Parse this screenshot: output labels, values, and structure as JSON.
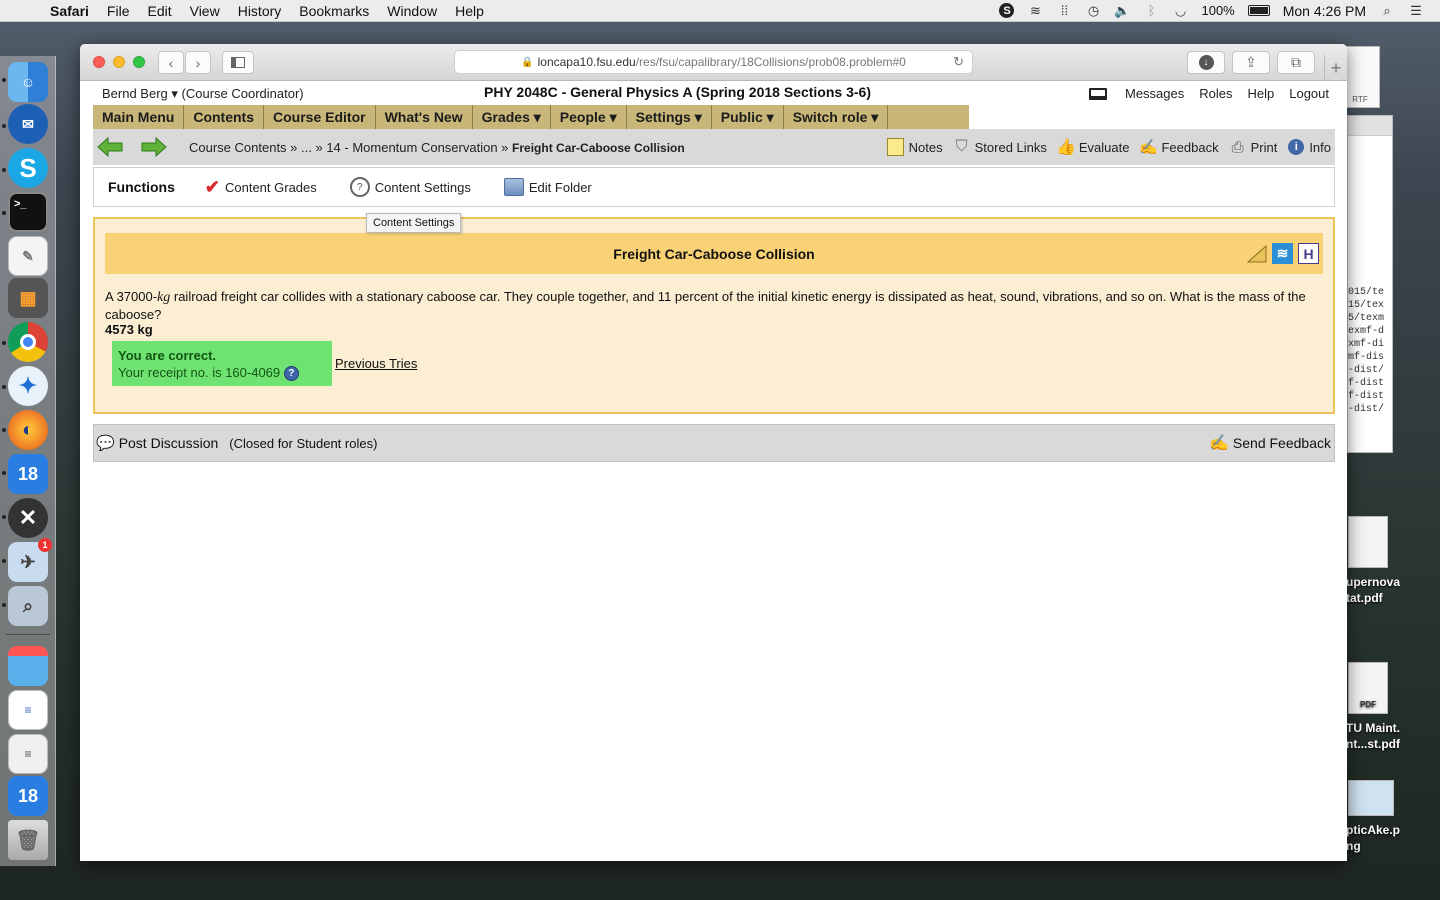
{
  "menubar": {
    "app": "Safari",
    "items": [
      "File",
      "Edit",
      "View",
      "History",
      "Bookmarks",
      "Window",
      "Help"
    ],
    "battery": "100%",
    "clock": "Mon 4:26 PM"
  },
  "dock": {
    "items": [
      "finder",
      "thunderbird",
      "skype",
      "terminal",
      "textedit",
      "calculator",
      "chrome",
      "safari",
      "firefox",
      "calendar-18",
      "x11",
      "preview",
      "image-capture",
      "file-merge",
      "ical",
      "xmgrace",
      "notes",
      "trash"
    ],
    "badge": "1",
    "calendar_day": "18"
  },
  "desktop": {
    "rtf_label": "RTF",
    "file1": "upernova\ntat.pdf",
    "file2": "TU Maint.\nnt...st.pdf",
    "file3": "pticAke.p\nng",
    "pdf_label": "PDF",
    "bg_text": "015/te\n15/tex\n5/texm\nexmf-d\nxmf-di\nmf-dis\n-dist/\nf-dist\nf-dist\n-dist/"
  },
  "browser": {
    "url_host": "loncapa10.fsu.edu",
    "url_path": "/res/fsu/capalibrary/18Collisions/prob08.problem#0"
  },
  "header": {
    "user": "Bernd Berg ▾",
    "role": "(Course Coordinator)",
    "course": "PHY 2048C - General Physics A (Spring 2018 Sections 3-6)",
    "links": [
      "Messages",
      "Roles",
      "Help",
      "Logout"
    ]
  },
  "mainmenu": [
    "Main Menu",
    "Contents",
    "Course Editor",
    "What's New",
    "Grades ▾",
    "People ▾",
    "Settings ▾",
    "Public ▾",
    "Switch role ▾"
  ],
  "breadcrumb": {
    "part1": "Course Contents",
    "sep1": " » ... » ",
    "part2": "14 - Momentum Conservation",
    "sep2": " » ",
    "current": "Freight Car-Caboose Collision"
  },
  "tools": [
    "Notes",
    "Stored Links",
    "Evaluate",
    "Feedback",
    "Print",
    "Info"
  ],
  "functions": {
    "title": "Functions",
    "items": [
      "Content Grades",
      "Content Settings",
      "Edit Folder"
    ],
    "tooltip": "Content Settings"
  },
  "problem": {
    "title": "Freight Car-Caboose Collision",
    "text_a": "A 37000-",
    "unit": "kg",
    "text_b": " railroad freight car collides with a stationary caboose car. They couple together, and 11 percent of the initial kinetic energy is dissipated as heat, sound, vibrations, and so on. What is the mass of the caboose?",
    "answer": "4573 kg",
    "status": "You are correct.",
    "receipt": "Your receipt no. is 160-4069",
    "previous": "Previous Tries"
  },
  "discussion": {
    "post": "Post Discussion",
    "closed": "(Closed for Student roles)",
    "feedback": "Send Feedback"
  },
  "colors": {
    "menu_bg": "#c9b779",
    "problem_bg": "#fbeed3",
    "problem_title_bg": "#f9d276",
    "correct_bg": "#6fe371"
  }
}
